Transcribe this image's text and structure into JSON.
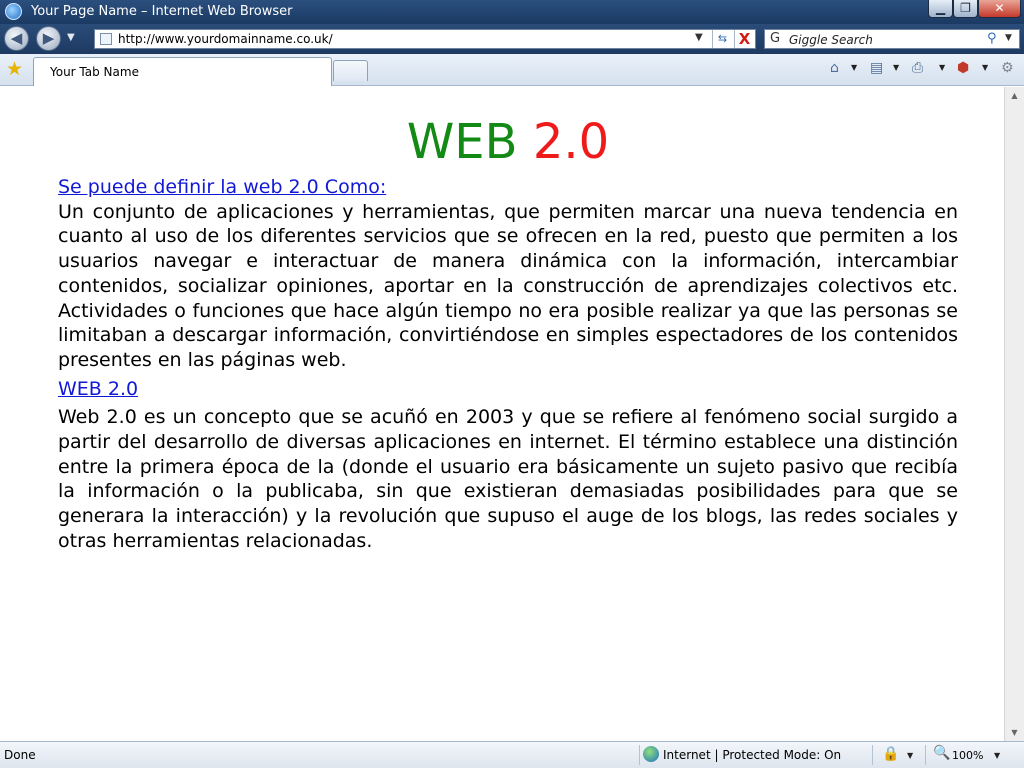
{
  "window": {
    "title": "Your Page Name – Internet Web Browser",
    "minimize_glyph": "▁",
    "maximize_glyph": "❐",
    "close_glyph": "✕"
  },
  "navigation": {
    "back_icon": "back-arrow-icon",
    "forward_icon": "forward-arrow-icon",
    "back_glyph": "◀",
    "forward_glyph": "▶",
    "history_dropdown_glyph": "▼"
  },
  "address": {
    "url": "http://www.yourdomainname.co.uk/",
    "dropdown_glyph": "▼",
    "refresh_glyph": "⇆",
    "stop_glyph": "X"
  },
  "search": {
    "placeholder": "Giggle Search",
    "engine_glyph": "G",
    "go_glyph": "⚲",
    "dropdown_glyph": "▼"
  },
  "tabs": {
    "favorites_glyph": "★",
    "active_tab_label": "Your Tab Name"
  },
  "command_bar": {
    "home_glyph": "⌂",
    "feeds_glyph": "▤",
    "print_glyph": "⎙",
    "safety_glyph": "⬢",
    "tools_glyph": "⚙",
    "dropdown_glyph": "▼"
  },
  "page": {
    "title_part1": "WEB",
    "title_part2": "2.0",
    "title_part1_color": "#138a16",
    "title_part2_color": "#ef1a1a",
    "link1": "Se puede definir la web 2.0   Como:",
    "paragraph1": "Un conjunto de aplicaciones y herramientas,  que permiten marcar una nueva tendencia en cuanto al uso de los diferentes  servicios que se ofrecen en la red, puesto que permiten a los usuarios navegar e interactuar de manera dinámica con la información, intercambiar contenidos, socializar opiniones,  aportar en la construcción de aprendizajes colectivos etc. Actividades o funciones que hace algún tiempo no era posible realizar  ya que las personas  se limitaban a descargar información, convirtiéndose en simples  espectadores  de los contenidos presentes en las páginas web.",
    "link2": "WEB 2.0",
    "paragraph2": "Web 2.0 es un concepto que se acuñó en 2003  y que se refiere al fenómeno social surgido a partir del desarrollo de diversas aplicaciones en internet. El término establece una distinción entre la primera época de la (donde el usuario era básicamente un sujeto pasivo que recibía la información o la publicaba, sin que existieran demasiadas posibilidades para que se generara la interacción) y la revolución que supuso el auge de los blogs, las redes sociales y otras herramientas relacionadas.",
    "link_color": "#1219d6"
  },
  "scrollbar": {
    "up_glyph": "▲",
    "down_glyph": "▼"
  },
  "status": {
    "text": "Done",
    "zone": "Internet | Protected Mode: On",
    "lock_glyph": "🔒",
    "zoom_glyph": "🔍",
    "zoom": "100%",
    "dropdown_glyph": "▼"
  }
}
